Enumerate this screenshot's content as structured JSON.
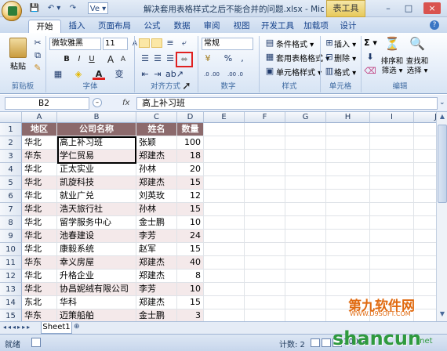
{
  "window": {
    "title": "解决套用表格样式之后不能合并的问题.xlsx - Microsoft Ex...",
    "context_tool": "表工具",
    "controls": [
      "–",
      "□",
      "×"
    ]
  },
  "qat": [
    "💾",
    "↶ ▾",
    "↷",
    "Ve ▾"
  ],
  "tabs": [
    "开始",
    "插入",
    "页面布局",
    "公式",
    "数据",
    "审阅",
    "视图",
    "开发工具",
    "加载项",
    "设计"
  ],
  "ribbon": {
    "clipboard": {
      "label": "剪贴板",
      "paste": "粘贴"
    },
    "font": {
      "label": "字体",
      "name": "微软雅黑",
      "size": "11",
      "bold": "B",
      "italic": "I",
      "underline": "U",
      "grow": "A",
      "shrink": "A",
      "color_a": "A",
      "wen": "变"
    },
    "alignment": {
      "label": "对齐方式"
    },
    "number": {
      "label": "数字",
      "format": "常规",
      "percent": "%",
      "comma": ",",
      "inc": ".0 .00",
      "dec": ".00 .0",
      "currency": "¥"
    },
    "styles": {
      "label": "样式",
      "items": [
        "条件格式 ▾",
        "套用表格格式 ▾",
        "单元格样式 ▾"
      ]
    },
    "cells": {
      "label": "单元格",
      "items": [
        "插入 ▾",
        "删除 ▾",
        "格式 ▾"
      ]
    },
    "editing": {
      "label": "编辑",
      "sum": "Σ ▾",
      "sort": "排序和\n筛选 ▾",
      "find": "查找和\n选择 ▾",
      "sort_l1": "排序和",
      "sort_l2": "筛选 ▾",
      "find_l1": "查找和",
      "find_l2": "选择 ▾"
    }
  },
  "formula_bar": {
    "name_box": "B2",
    "fx": "fx",
    "content": "高上补习班"
  },
  "columns": [
    "A",
    "B",
    "C",
    "D",
    "E",
    "F",
    "G",
    "H",
    "I",
    "J"
  ],
  "rows": [
    "1",
    "2",
    "3",
    "4",
    "5",
    "6",
    "7",
    "8",
    "9",
    "10",
    "11",
    "12",
    "13",
    "14",
    "15"
  ],
  "table": {
    "headers": [
      "地区",
      "公司名称",
      "姓名",
      "数量"
    ],
    "data": [
      [
        "华北",
        "高上补习班",
        "张颖",
        "100"
      ],
      [
        "华东",
        "学仁贸易",
        "郑建杰",
        "18"
      ],
      [
        "华北",
        "正太实业",
        "孙林",
        "20"
      ],
      [
        "华北",
        "凯旋科技",
        "郑建杰",
        "15"
      ],
      [
        "华北",
        "就业广兑",
        "刘英玫",
        "12"
      ],
      [
        "华北",
        "浩天旅行社",
        "孙林",
        "15"
      ],
      [
        "华北",
        "留学服务中心",
        "金士鹏",
        "10"
      ],
      [
        "华北",
        "池春建设",
        "李芳",
        "24"
      ],
      [
        "华北",
        "康毅系统",
        "赵军",
        "15"
      ],
      [
        "华东",
        "幸义房屋",
        "郑建杰",
        "40"
      ],
      [
        "华北",
        "升格企业",
        "郑建杰",
        "8"
      ],
      [
        "华北",
        "协昌妮绒有限公司",
        "李芳",
        "10"
      ],
      [
        "东北",
        "华科",
        "郑建杰",
        "15"
      ],
      [
        "华东",
        "迈策船舶",
        "金士鹏",
        "3"
      ]
    ]
  },
  "sheet_tab": "Sheet1",
  "status": {
    "mode": "就绪",
    "count_label": "计数: 2",
    "zoom": "100%"
  },
  "watermark": {
    "brand": "第九软件网",
    "url": "WWW.D9SOFT.COM",
    "site": "shancun",
    "tld": ".net"
  }
}
